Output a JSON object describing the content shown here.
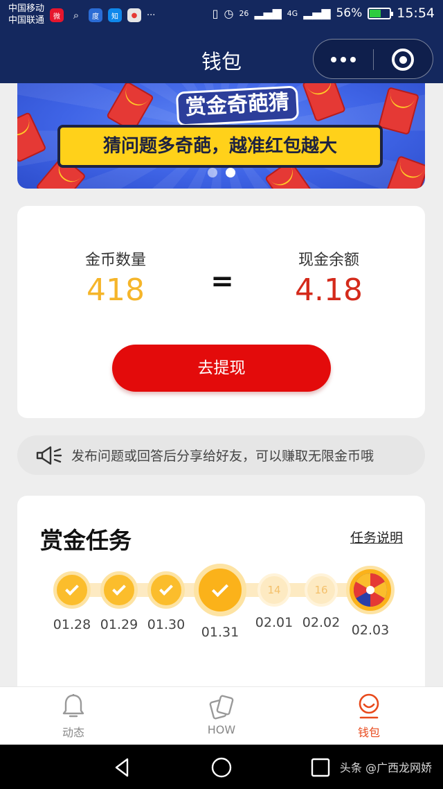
{
  "status_bar": {
    "carrier_1": "中国移动",
    "carrier_2": "中国联通",
    "app_icons": [
      {
        "name": "weibo-icon",
        "glyph": "微",
        "color": "#e6162d"
      },
      {
        "name": "search-icon",
        "glyph": "",
        "color": "#14285e"
      },
      {
        "name": "baidu-icon",
        "glyph": "度",
        "color": "#2b6cd4"
      },
      {
        "name": "zhihu-icon",
        "glyph": "知",
        "color": "#0f88eb"
      },
      {
        "name": "map-icon",
        "glyph": "●",
        "color": "#e6e6e6"
      }
    ],
    "overflow": "···",
    "signal_1": "26",
    "signal_2": "4G",
    "battery": "56%",
    "battery_level": 0.56,
    "time": "15:54"
  },
  "nav": {
    "title": "钱包"
  },
  "banner": {
    "title": "赏金奇葩猜",
    "subtitle": "猜问题多奇葩，越准红包越大",
    "active_slide": 1,
    "slide_count": 2
  },
  "wallet": {
    "coin_label": "金币数量",
    "coin_value": "418",
    "equals": "=",
    "cash_label": "现金余额",
    "cash_value": "4.18",
    "withdraw_label": "去提现",
    "coin_color": "#f5b52a",
    "cash_color": "#d42a1b"
  },
  "notice": {
    "text": "发布问题或回答后分享给好友，可以赚取无限金币哦"
  },
  "tasks": {
    "title": "赏金任务",
    "help_link": "任务说明",
    "days": [
      {
        "date": "01.28",
        "state": "done",
        "reward": ""
      },
      {
        "date": "01.29",
        "state": "done",
        "reward": ""
      },
      {
        "date": "01.30",
        "state": "done",
        "reward": ""
      },
      {
        "date": "01.31",
        "state": "today",
        "reward": ""
      },
      {
        "date": "02.01",
        "state": "todo",
        "reward": "14"
      },
      {
        "date": "02.02",
        "state": "todo",
        "reward": "16"
      },
      {
        "date": "02.03",
        "state": "wheel",
        "reward": ""
      }
    ]
  },
  "tabbar": {
    "tabs": [
      {
        "label": "动态",
        "icon": "bell-icon",
        "active": false
      },
      {
        "label": "HOW",
        "icon": "cards-icon",
        "active": false
      },
      {
        "label": "钱包",
        "icon": "wallet-smile-icon",
        "active": true
      }
    ]
  },
  "system_nav": {
    "watermark": "头条 @广西龙网娇"
  }
}
